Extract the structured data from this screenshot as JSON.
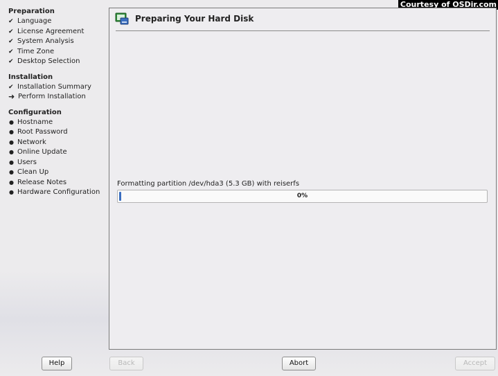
{
  "watermark": "Courtesy of OSDir.com",
  "sidebar": {
    "sections": [
      {
        "title": "Preparation",
        "items": [
          {
            "label": "Language",
            "status": "done"
          },
          {
            "label": "License Agreement",
            "status": "done"
          },
          {
            "label": "System Analysis",
            "status": "done"
          },
          {
            "label": "Time Zone",
            "status": "done"
          },
          {
            "label": "Desktop Selection",
            "status": "done"
          }
        ]
      },
      {
        "title": "Installation",
        "items": [
          {
            "label": "Installation Summary",
            "status": "done"
          },
          {
            "label": "Perform Installation",
            "status": "current"
          }
        ]
      },
      {
        "title": "Configuration",
        "items": [
          {
            "label": "Hostname",
            "status": "pending"
          },
          {
            "label": "Root Password",
            "status": "pending"
          },
          {
            "label": "Network",
            "status": "pending"
          },
          {
            "label": "Online Update",
            "status": "pending"
          },
          {
            "label": "Users",
            "status": "pending"
          },
          {
            "label": "Clean Up",
            "status": "pending"
          },
          {
            "label": "Release Notes",
            "status": "pending"
          },
          {
            "label": "Hardware Configuration",
            "status": "pending"
          }
        ]
      }
    ]
  },
  "main": {
    "title": "Preparing Your Hard Disk",
    "title_icon": "hard-disk-icon",
    "progress_label": "Formatting partition /dev/hda3 (5.3 GB) with reiserfs",
    "progress_text": "0%",
    "progress_value": 0.0
  },
  "buttons": {
    "help": "Help",
    "back": "Back",
    "abort": "Abort",
    "accept": "Accept"
  },
  "colors": {
    "progress_fill": "#3a6ec0",
    "background": "#ecebed"
  }
}
